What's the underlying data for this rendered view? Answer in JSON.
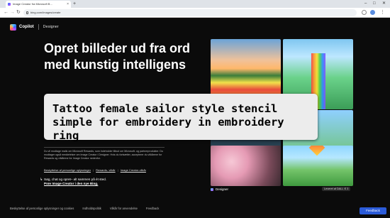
{
  "browser": {
    "tab_title": "Image Creator fra Microsoft B...",
    "url": "bing.com/images/create",
    "new_tab": "+",
    "minimize": "–",
    "maximize": "□",
    "close": "✕",
    "tab_close": "×"
  },
  "brand": {
    "name": "Copilot",
    "product": "Designer"
  },
  "hero": {
    "title": "Opret billeder ud fra ord med kunstig intelligens"
  },
  "overlay": {
    "text": "Tattoo female sailor style stencil simple for embroidery in embroidery ring"
  },
  "legal": {
    "description": "Du vil modtage mails om Microsoft Rewards, som indeholder tilbud om Microsoft- og partnerprodukter. Du modtager også meddelelser om Image Creator i Designer. Hvis du fortsætter, accepterer du vilkårene for Rewards og vilkårene for Image Creator nedenfor.",
    "links": [
      "Beskyttelse af personlige oplysninger",
      "Rewards- vilkår",
      "Image Creator-vilkår"
    ]
  },
  "promo": {
    "line1": "Søg, chat og opret– alt sammen på ét sted.",
    "link": "Prøv Image Creator i den nye Bing."
  },
  "gallery": {
    "designer_label": "Designer",
    "dalle_badge": "Leveret af DALL·E 3"
  },
  "footer": {
    "links": [
      "Beskyttelse af personlige oplysninger og cookies",
      "Indholdspolitik",
      "Vilkår for anvendelse",
      "Feedback"
    ],
    "feedback_button": "Feedback"
  }
}
